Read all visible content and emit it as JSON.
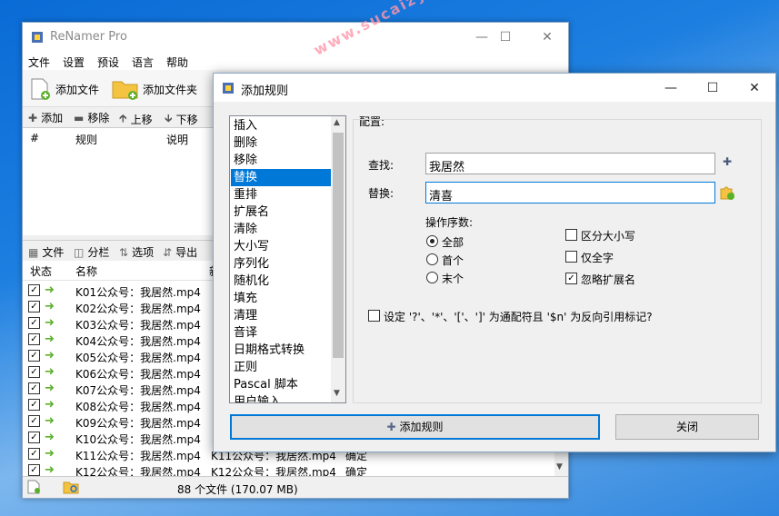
{
  "main": {
    "title": "ReNamer Pro",
    "menu": [
      "文件",
      "设置",
      "预设",
      "语言",
      "帮助"
    ],
    "toolbar": {
      "add_files": "添加文件",
      "add_folders": "添加文件夹"
    },
    "rules_bar": {
      "add": "添加",
      "remove": "移除",
      "up": "上移",
      "down": "下移"
    },
    "rules_headers": {
      "num": "#",
      "rule": "规则",
      "desc": "说明"
    },
    "files_bar": {
      "files": "文件",
      "columns": "分栏",
      "options": "选项",
      "export": "导出"
    },
    "file_headers": {
      "state": "状态",
      "name": "名称",
      "new": "新"
    },
    "files": [
      {
        "name": "K01公众号：我居然.mp4",
        "new": "",
        "status": ""
      },
      {
        "name": "K02公众号：我居然.mp4",
        "new": "",
        "status": ""
      },
      {
        "name": "K03公众号：我居然.mp4",
        "new": "",
        "status": ""
      },
      {
        "name": "K04公众号：我居然.mp4",
        "new": "",
        "status": ""
      },
      {
        "name": "K05公众号：我居然.mp4",
        "new": "",
        "status": ""
      },
      {
        "name": "K06公众号：我居然.mp4",
        "new": "",
        "status": ""
      },
      {
        "name": "K07公众号：我居然.mp4",
        "new": "",
        "status": ""
      },
      {
        "name": "K08公众号：我居然.mp4",
        "new": "",
        "status": ""
      },
      {
        "name": "K09公众号：我居然.mp4",
        "new": "",
        "status": ""
      },
      {
        "name": "K10公众号：我居然.mp4",
        "new": "",
        "status": ""
      },
      {
        "name": "K11公众号：我居然.mp4",
        "new": "K11公众号：我居然.mp4",
        "status": "确定"
      },
      {
        "name": "K12公众号：我居然.mp4",
        "new": "K12公众号：我居然.mp4",
        "status": "确定"
      }
    ],
    "status_text": "88 个文件 (170.07 MB)"
  },
  "dialog": {
    "title": "添加规则",
    "rules": [
      "插入",
      "删除",
      "移除",
      "替换",
      "重排",
      "扩展名",
      "清除",
      "大小写",
      "序列化",
      "随机化",
      "填充",
      "清理",
      "音译",
      "日期格式转换",
      "正则",
      "Pascal 脚本",
      "用户输入"
    ],
    "selected_rule": "替换",
    "config_label": "配置:",
    "find_label": "查找:",
    "find_value": "我居然",
    "replace_label": "替换:",
    "replace_value": "清喜",
    "occurrences_label": "操作序数:",
    "occ_all": "全部",
    "occ_first": "首个",
    "occ_last": "末个",
    "case_sensitive": "区分大小写",
    "whole_words": "仅全字",
    "skip_extension": "忽略扩展名",
    "wildcards": "设定 '?'、'*'、'['、']' 为通配符且 '$n' 为反向引用标记?",
    "add_rule_button": "添加规则",
    "close_button": "关闭"
  },
  "watermark": "www.sucaizy.com"
}
